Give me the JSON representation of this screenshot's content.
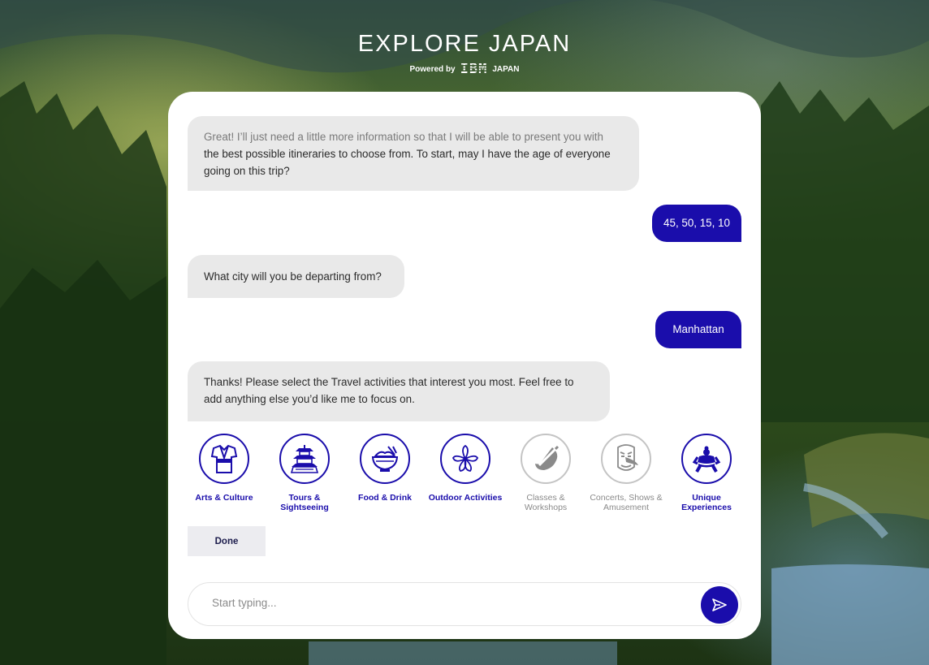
{
  "header": {
    "title": "EXPLORE JAPAN",
    "powered_by": "Powered by",
    "ibm": "IBM",
    "region": "JAPAN"
  },
  "chat": {
    "messages": [
      {
        "from": "bot",
        "line1": "Great! I’ll just need a little more information so that I will be able to present you with",
        "line2": "the best possible itineraries to choose from. To start, may I have the age of everyone going on this trip?"
      },
      {
        "from": "user",
        "text": "45, 50, 15, 10"
      },
      {
        "from": "bot",
        "text": "What city will you be departing from?"
      },
      {
        "from": "user",
        "text": "Manhattan"
      },
      {
        "from": "bot",
        "text": "Thanks! Please select the Travel activities that interest you most. Feel free to add anything else you’d like me to focus on."
      }
    ],
    "activities": [
      {
        "label": "Arts & Culture",
        "icon": "kimono-icon",
        "selected": true
      },
      {
        "label": "Tours & Sightseeing",
        "icon": "pagoda-icon",
        "selected": true
      },
      {
        "label": "Food & Drink",
        "icon": "rice-bowl-icon",
        "selected": true
      },
      {
        "label": "Outdoor Activities",
        "icon": "cherry-blossom-icon",
        "selected": true
      },
      {
        "label": "Classes & Workshops",
        "icon": "brush-icon",
        "selected": false
      },
      {
        "label": "Concerts, Shows & Amusement",
        "icon": "tengu-mask-icon",
        "selected": false
      },
      {
        "label": "Unique Experiences",
        "icon": "sumo-icon",
        "selected": true
      }
    ],
    "done_label": "Done",
    "input_placeholder": "Start typing..."
  },
  "colors": {
    "accent": "#1a0dab",
    "bot_bubble": "#e9e9e9",
    "inactive": "#8a8a8a"
  }
}
